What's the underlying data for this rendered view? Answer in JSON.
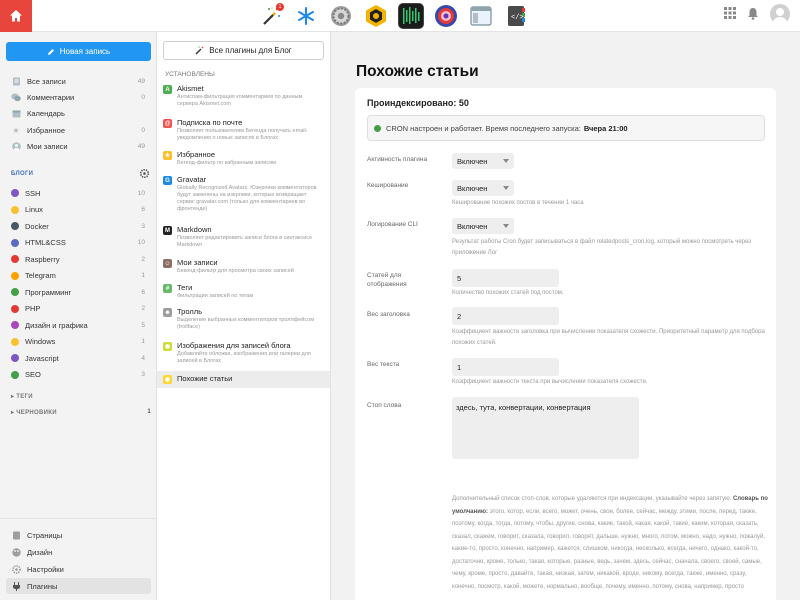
{
  "dock": [
    {
      "name": "magic-wand-app",
      "badge": "1"
    },
    {
      "name": "snowflake-app"
    },
    {
      "name": "settings-gear-app"
    },
    {
      "name": "hexagon-app"
    },
    {
      "name": "terminal-app"
    },
    {
      "name": "camera-app"
    },
    {
      "name": "window-app"
    },
    {
      "name": "code-editor-app"
    }
  ],
  "sidebar": {
    "new_post": "Новая запись",
    "main_items": [
      {
        "label": "Все записи",
        "count": "49"
      },
      {
        "label": "Комментарии",
        "count": "0"
      },
      {
        "label": "Календарь",
        "count": ""
      },
      {
        "label": "Избранное",
        "count": "0"
      },
      {
        "label": "Мои записи",
        "count": "49"
      }
    ],
    "blogs_label": "БЛОГИ",
    "blogs": [
      {
        "label": "SSH",
        "count": "10",
        "color": "#7e57c2"
      },
      {
        "label": "Linux",
        "count": "6",
        "color": "#fbc02d"
      },
      {
        "label": "Docker",
        "count": "3",
        "color": "#455a64"
      },
      {
        "label": "HTML&CSS",
        "count": "10",
        "color": "#5c6bc0"
      },
      {
        "label": "Raspberry",
        "count": "2",
        "color": "#e53935"
      },
      {
        "label": "Telegram",
        "count": "1",
        "color": "#ffa000"
      },
      {
        "label": "Программинг",
        "count": "6",
        "color": "#43a047"
      },
      {
        "label": "PHP",
        "count": "2",
        "color": "#e53935"
      },
      {
        "label": "Дизайн и графика",
        "count": "5",
        "color": "#ab47bc"
      },
      {
        "label": "Windows",
        "count": "1",
        "color": "#fbc02d"
      },
      {
        "label": "Javascript",
        "count": "4",
        "color": "#7e57c2"
      },
      {
        "label": "SEO",
        "count": "3",
        "color": "#43a047"
      }
    ],
    "tags_label": "ТЕГИ",
    "drafts_label": "ЧЕРНОВИКИ",
    "drafts_count": "1",
    "bottom": [
      {
        "label": "Страницы"
      },
      {
        "label": "Дизайн"
      },
      {
        "label": "Настройки"
      },
      {
        "label": "Плагины"
      }
    ]
  },
  "plugins": {
    "all_button": "Все плагины для Блог",
    "installed_label": "УСТАНОВЛЕНЫ",
    "items": [
      {
        "name": "Akismet",
        "desc": "Антиспам-фильтрация комментариев по данным сервера Akismet.com",
        "color": "#4caf50",
        "glyph": "A"
      },
      {
        "name": "Подписка по почте",
        "desc": "Позволяет пользователям Бегенда получать email-уведомления о новых записях в Блогах",
        "color": "#ef5350",
        "glyph": "@"
      },
      {
        "name": "Избранное",
        "desc": "Бегенд-фильтр по избранным записям",
        "color": "#fbc02d",
        "glyph": "★"
      },
      {
        "name": "Gravatar",
        "desc": "Globally Recognized Avatars. Юзерпики комментаторов будут заменены на изерпики, которые возвращает сервис gravatar.com (только для комментариев во фронтенде)",
        "color": "#1e88e5",
        "glyph": "G"
      },
      {
        "name": "Markdown",
        "desc": "Позволяет редактировать записи блога в синтаксисе Markdown",
        "color": "#222222",
        "glyph": "M"
      },
      {
        "name": "Мои записи",
        "desc": "Бекенд-фильтр для просмотра своих записей",
        "color": "#8d6e63",
        "glyph": "☺"
      },
      {
        "name": "Теги",
        "desc": "Фильтрация записей по тегам",
        "color": "#66bb6a",
        "glyph": "#"
      },
      {
        "name": "Тролль",
        "desc": "Выделение выбранных комментаторов троллфейсом (trollface)",
        "color": "#9e9e9e",
        "glyph": "☻"
      },
      {
        "name": "Изображения для записей блога",
        "desc": "Добавляйте обложки, изображения или галереи для записей в Блогах",
        "color": "#cddc39",
        "glyph": "◉"
      },
      {
        "name": "Похожие статьи",
        "desc": "",
        "color": "#fdd835",
        "glyph": "◉"
      }
    ]
  },
  "main": {
    "title": "Похожие статьи",
    "indexed": "Проиндексировано: 50",
    "cron_text": "CRON настроен и работает. Время последнего запуска:",
    "cron_time": "Вчера 21:00",
    "fields": {
      "plugin_active_label": "Активность плагина",
      "plugin_active_value": "Включен",
      "cache_label": "Кеширование",
      "cache_value": "Включен",
      "cache_hint": "Кеширование похожих постов в течении 1 часа",
      "log_label": "Логирование CLI",
      "log_value": "Включен",
      "log_hint": "Результат работы Cron будет записываться в файл relatedposts_cron.log, который можно посмотреть через приложение Лог",
      "count_label": "Статей для отображения",
      "count_value": "5",
      "count_hint": "Количество похожих статей под постом.",
      "title_weight_label": "Вес заголовка",
      "title_weight_value": "2",
      "title_weight_hint": "Коэффициент важности заголовка при вычислении показателя схожести. Приоритетный параметр для подбора похожих статей.",
      "text_weight_label": "Вес текста",
      "text_weight_value": "1",
      "text_weight_hint": "Коэффициент важности текста при вычислении показателя схожести.",
      "stop_label": "Стоп слова",
      "stop_value": "здесь, тута, конвертации, конвертация",
      "stop_hint_intro": "Дополнительный список стоп-слов, которые удаляются при индексации, указывайте через запятую.",
      "stop_hint_default_label": "Словарь по умолчанию:",
      "stop_hint_default": "этого, котор, если, всего, может, очень, свое, более, сейчас, между, этими, после, перед, также, поэтому, когда, тогда, потому, чтобы, другие, снова, какие, такой, какая, какой, такие, каким, которая, сказать, сказал, скажем, говорит, сказала, говорил, говорят, дальше, нужно, много, потом, можно, надо, нужно, пожалуй, какие-то, просто, конечно, например, кажется, слишком, никогда, несколько, всегда, ничего, однако, какой-то, достаточно, кроме, только, такая, которые, разные, ведь, зачем, здесь, сейчас, сначала, своего, своей, самые, чему, кроме, просто, давайте, такая, низкая, затем, никакой, вроде, никому, всегда, также, именно, сразу, конечно, посмотр, какой, можете, нормально, вообще, почему, именно, потому, снова, например, просто"
    }
  }
}
